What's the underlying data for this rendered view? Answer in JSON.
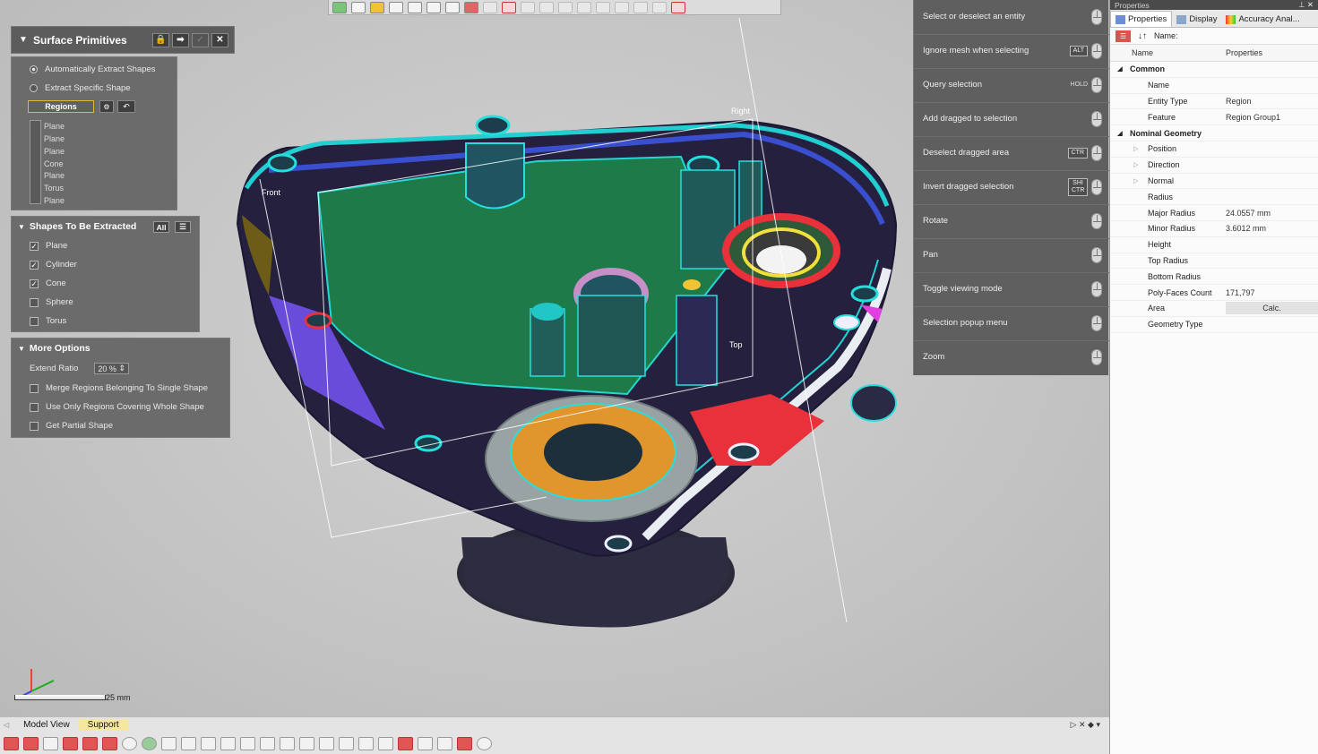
{
  "surface_primitives": {
    "title": "Surface Primitives",
    "radio_auto": "Automatically Extract Shapes",
    "radio_specific": "Extract Specific Shape",
    "regions_tab": "Regions",
    "region_list": [
      "Plane",
      "Plane",
      "Plane",
      "Cone",
      "Plane",
      "Torus",
      "Plane"
    ]
  },
  "shapes_section": {
    "title": "Shapes To Be Extracted",
    "all_label": "All",
    "items": [
      {
        "label": "Plane",
        "checked": true
      },
      {
        "label": "Cylinder",
        "checked": true
      },
      {
        "label": "Cone",
        "checked": true
      },
      {
        "label": "Sphere",
        "checked": false
      },
      {
        "label": "Torus",
        "checked": false
      }
    ]
  },
  "more_options": {
    "title": "More Options",
    "extend_ratio_label": "Extend Ratio",
    "extend_ratio_value": "20 %",
    "opt1": "Merge Regions Belonging To Single Shape",
    "opt2": "Use Only Regions Covering Whole Shape",
    "opt3": "Get Partial Shape"
  },
  "mouse_panel": [
    {
      "label": "Select or deselect an entity",
      "key": ""
    },
    {
      "label": "Ignore mesh when selecting",
      "key": "ALT"
    },
    {
      "label": "Query selection",
      "key": "HOLD"
    },
    {
      "label": "Add dragged to selection",
      "key": ""
    },
    {
      "label": "Deselect dragged area",
      "key": "CTR"
    },
    {
      "label": "Invert dragged selection",
      "key": "SHI CTR"
    },
    {
      "label": "Rotate",
      "key": ""
    },
    {
      "label": "Pan",
      "key": ""
    },
    {
      "label": "Toggle viewing mode",
      "key": ""
    },
    {
      "label": "Selection popup menu",
      "key": ""
    },
    {
      "label": "Zoom",
      "key": ""
    }
  ],
  "properties": {
    "panel_title": "Properties",
    "tabs": [
      "Properties",
      "Display",
      "Accuracy Anal..."
    ],
    "name_label": "Name:",
    "col_name": "Name",
    "col_props": "Properties",
    "rows": [
      {
        "name": "Common",
        "value": "",
        "category": true
      },
      {
        "name": "Name",
        "value": ""
      },
      {
        "name": "Entity Type",
        "value": "Region"
      },
      {
        "name": "Feature",
        "value": "Region Group1"
      },
      {
        "name": "Nominal Geometry",
        "value": "",
        "category": true
      },
      {
        "name": "Position",
        "value": "",
        "expand": true
      },
      {
        "name": "Direction",
        "value": "",
        "expand": true
      },
      {
        "name": "Normal",
        "value": "",
        "expand": true
      },
      {
        "name": "Radius",
        "value": ""
      },
      {
        "name": "Major Radius",
        "value": "24.0557 mm"
      },
      {
        "name": "Minor Radius",
        "value": "3.6012 mm"
      },
      {
        "name": "Height",
        "value": ""
      },
      {
        "name": "Top Radius",
        "value": ""
      },
      {
        "name": "Bottom Radius",
        "value": ""
      },
      {
        "name": "Poly-Faces Count",
        "value": "171,797"
      },
      {
        "name": "Area",
        "value": "",
        "button": "Calc."
      },
      {
        "name": "Geometry Type",
        "value": ""
      }
    ]
  },
  "viewport": {
    "label_front": "Front",
    "label_right": "Right",
    "label_top": "Top",
    "scale_label": "25 mm"
  },
  "bottom_tabs": [
    "Model View",
    "Support"
  ]
}
